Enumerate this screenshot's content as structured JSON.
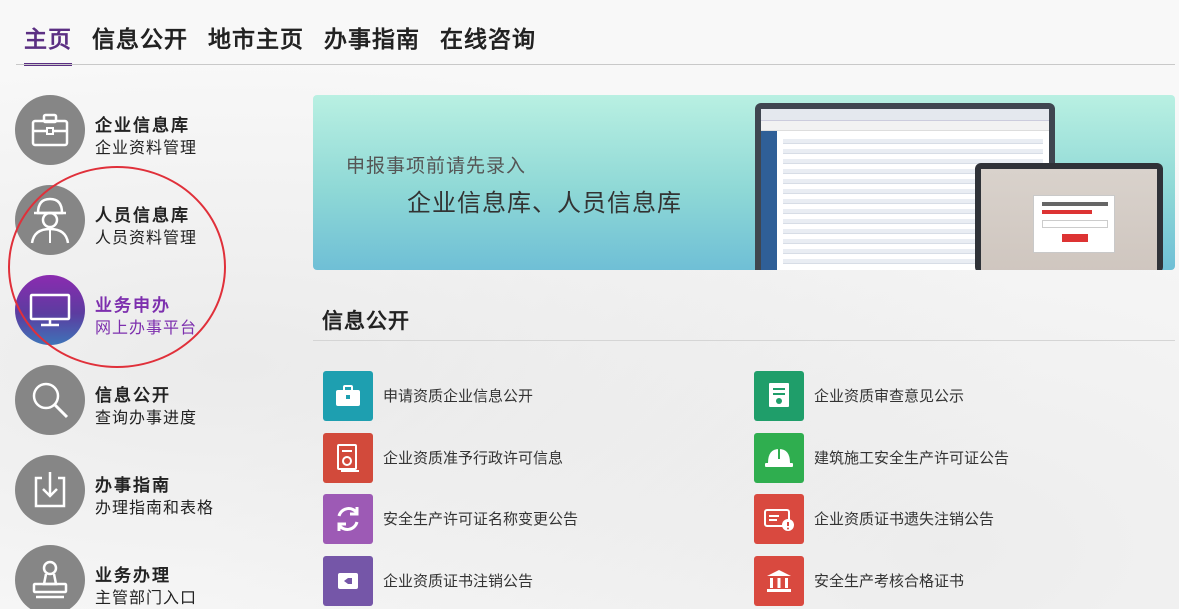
{
  "nav": {
    "tabs": [
      {
        "label": "主页",
        "active": true
      },
      {
        "label": "信息公开",
        "active": false
      },
      {
        "label": "地市主页",
        "active": false
      },
      {
        "label": "办事指南",
        "active": false
      },
      {
        "label": "在线咨询",
        "active": false
      }
    ]
  },
  "sidebar": {
    "items": [
      {
        "title": "企业信息库",
        "subtitle": "企业资料管理",
        "icon": "briefcase-icon",
        "active": false
      },
      {
        "title": "人员信息库",
        "subtitle": "人员资料管理",
        "icon": "worker-icon",
        "active": false
      },
      {
        "title": "业务申办",
        "subtitle": "网上办事平台",
        "icon": "monitor-icon",
        "active": true
      },
      {
        "title": "信息公开",
        "subtitle": "查询办事进度",
        "icon": "search-icon",
        "active": false
      },
      {
        "title": "办事指南",
        "subtitle": "办理指南和表格",
        "icon": "download-icon",
        "active": false
      },
      {
        "title": "业务办理",
        "subtitle": "主管部门入口",
        "icon": "stamp-icon",
        "active": false
      }
    ],
    "active_color": "#7d2fae",
    "inactive_circle_color": "#868686"
  },
  "banner": {
    "line1": "申报事项前请先录入",
    "line2": "企业信息库、人员信息库"
  },
  "info": {
    "title": "信息公开",
    "items": [
      {
        "label": "申请资质企业信息公开",
        "icon": "briefcase-icon",
        "color": "#1e9fb0"
      },
      {
        "label": "企业资质审查意见公示",
        "icon": "certificate-icon",
        "color": "#1f9e6a"
      },
      {
        "label": "企业资质准予行政许可信息",
        "icon": "document-stamp-icon",
        "color": "#d24a3b"
      },
      {
        "label": "建筑施工安全生产许可证公告",
        "icon": "hardhat-icon",
        "color": "#2fae4f"
      },
      {
        "label": "安全生产许可证名称变更公告",
        "icon": "refresh-icon",
        "color": "#9d5ab5"
      },
      {
        "label": "企业资质证书遗失注销公告",
        "icon": "id-card-alert-icon",
        "color": "#d9493f"
      },
      {
        "label": "企业资质证书注销公告",
        "icon": "certificate-delete-icon",
        "color": "#7556a8"
      },
      {
        "label": "安全生产考核合格证书",
        "icon": "institution-icon",
        "color": "#d9493f"
      }
    ]
  }
}
